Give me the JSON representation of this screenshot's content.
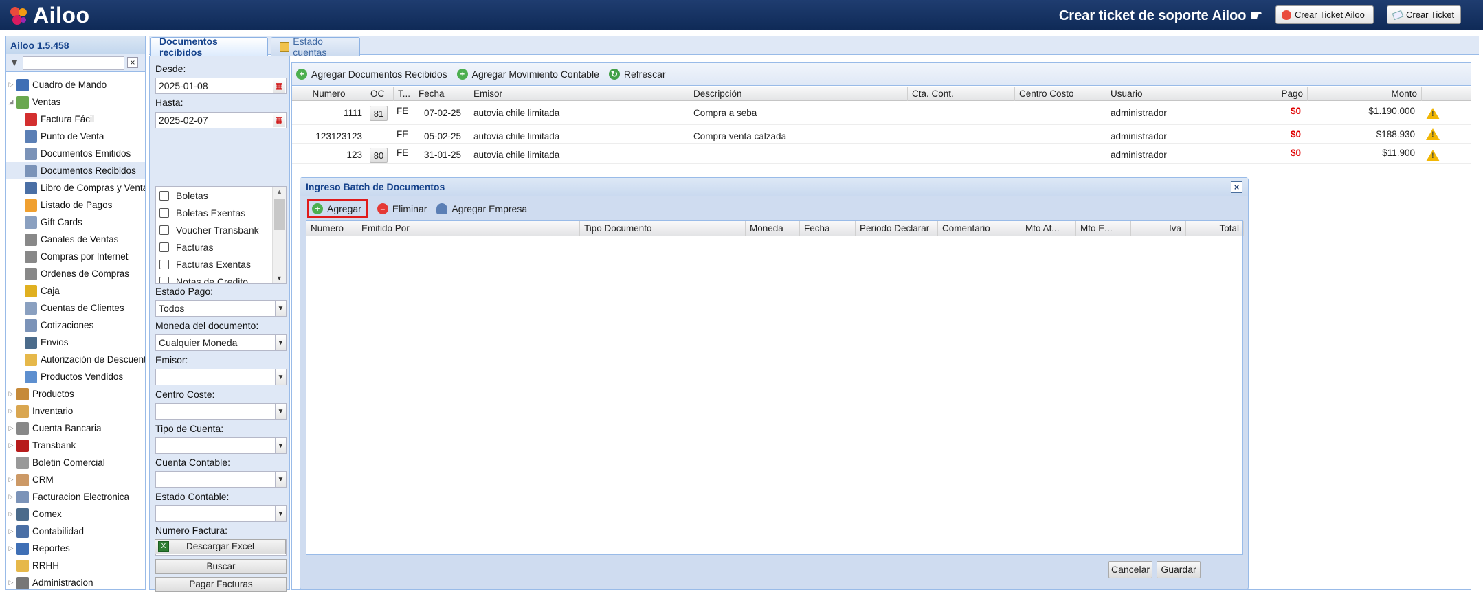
{
  "app": {
    "logo_text": "Ailoo",
    "support_title": "Crear ticket de soporte Ailoo ☛",
    "btn_crear_ticket_ailoo": "Crear Ticket Ailoo",
    "btn_crear_ticket": "Crear Ticket"
  },
  "sidebar": {
    "title": "Ailoo 1.5.458",
    "search_placeholder": "",
    "items": [
      {
        "label": "Cuadro de Mando",
        "icon": "chart-icon",
        "level": 0,
        "expander": "▷"
      },
      {
        "label": "Ventas",
        "icon": "money-icon",
        "level": 0,
        "expander": "◢"
      },
      {
        "label": "Factura Fácil",
        "icon": "ribbon-icon",
        "level": 1
      },
      {
        "label": "Punto de Venta",
        "icon": "pos-icon",
        "level": 1
      },
      {
        "label": "Documentos Emitidos",
        "icon": "document-icon",
        "level": 1
      },
      {
        "label": "Documentos Recibidos",
        "icon": "document-icon",
        "level": 1,
        "selected": true
      },
      {
        "label": "Libro de Compras y Ventas",
        "icon": "book-icon",
        "level": 1
      },
      {
        "label": "Listado de Pagos",
        "icon": "calculator-icon",
        "level": 1
      },
      {
        "label": "Gift Cards",
        "icon": "card-icon",
        "level": 1
      },
      {
        "label": "Canales de Ventas",
        "icon": "cart-icon",
        "level": 1
      },
      {
        "label": "Compras por Internet",
        "icon": "cart-icon",
        "level": 1
      },
      {
        "label": "Ordenes de Compras",
        "icon": "cart-icon",
        "level": 1
      },
      {
        "label": "Caja",
        "icon": "coins-icon",
        "level": 1
      },
      {
        "label": "Cuentas de Clientes",
        "icon": "card-icon",
        "level": 1
      },
      {
        "label": "Cotizaciones",
        "icon": "document-icon",
        "level": 1
      },
      {
        "label": "Envios",
        "icon": "truck-icon",
        "level": 1
      },
      {
        "label": "Autorización de Descuentos",
        "icon": "folder-icon",
        "level": 1
      },
      {
        "label": "Productos Vendidos",
        "icon": "table-icon",
        "level": 1
      },
      {
        "label": "Productos",
        "icon": "box-icon",
        "level": 0,
        "expander": "▷"
      },
      {
        "label": "Inventario",
        "icon": "package-icon",
        "level": 0,
        "expander": "▷"
      },
      {
        "label": "Cuenta Bancaria",
        "icon": "bank-icon",
        "level": 0,
        "expander": "▷"
      },
      {
        "label": "Transbank",
        "icon": "transbank-icon",
        "level": 0,
        "expander": "▷"
      },
      {
        "label": "Boletin Comercial",
        "icon": "tag-icon",
        "level": 0,
        "expander": ""
      },
      {
        "label": "CRM",
        "icon": "users-icon",
        "level": 0,
        "expander": "▷"
      },
      {
        "label": "Facturacion Electronica",
        "icon": "document-icon",
        "level": 0,
        "expander": "▷"
      },
      {
        "label": "Comex",
        "icon": "truck-icon",
        "level": 0,
        "expander": "▷"
      },
      {
        "label": "Contabilidad",
        "icon": "book-icon",
        "level": 0,
        "expander": "▷"
      },
      {
        "label": "Reportes",
        "icon": "chart-icon",
        "level": 0,
        "expander": "▷"
      },
      {
        "label": "RRHH",
        "icon": "folder-icon",
        "level": 0,
        "expander": ""
      },
      {
        "label": "Administracion",
        "icon": "gear-icon",
        "level": 0,
        "expander": "▷"
      }
    ]
  },
  "tabs": [
    {
      "label": "Documentos recibidos",
      "active": true
    },
    {
      "label": "Estado cuentas",
      "active": false
    }
  ],
  "filters": {
    "desde_label": "Desde:",
    "desde_value": "2025-01-08",
    "hasta_label": "Hasta:",
    "hasta_value": "2025-02-07",
    "doc_types": [
      "Boletas",
      "Boletas Exentas",
      "Voucher Transbank",
      "Facturas",
      "Facturas Exentas",
      "Notas de Credito"
    ],
    "estado_pago_label": "Estado Pago:",
    "estado_pago_value": "Todos",
    "moneda_label": "Moneda del documento:",
    "moneda_value": "Cualquier Moneda",
    "emisor_label": "Emisor:",
    "centro_coste_label": "Centro Coste:",
    "tipo_cuenta_label": "Tipo de Cuenta:",
    "cuenta_contable_label": "Cuenta Contable:",
    "estado_contable_label": "Estado Contable:",
    "numero_factura_label": "Numero Factura:",
    "buscar": "Buscar",
    "pagar_facturas": "Pagar Facturas",
    "descargar_excel": "Descargar Excel"
  },
  "grid": {
    "toolbar": {
      "agregar_docs": "Agregar Documentos Recibidos",
      "agregar_mov": "Agregar Movimiento Contable",
      "refrescar": "Refrescar"
    },
    "columns": [
      "Numero",
      "OC",
      "T...",
      "Fecha",
      "Emisor",
      "Descripción",
      "Cta. Cont.",
      "Centro Costo",
      "Usuario",
      "Pago",
      "Monto"
    ],
    "rows": [
      {
        "numero": "1111",
        "oc": "81",
        "tipo": "FE",
        "fecha": "07-02-25",
        "emisor": "autovia chile limitada",
        "descripcion": "Compra a seba",
        "usuario": "administrador",
        "pago": "$0",
        "monto": "$1.190.000"
      },
      {
        "numero": "123123123",
        "oc": "",
        "tipo": "FE",
        "fecha": "05-02-25",
        "emisor": "autovia chile limitada",
        "descripcion": "Compra venta calzada",
        "usuario": "administrador",
        "pago": "$0",
        "monto": "$188.930"
      },
      {
        "numero": "123",
        "oc": "80",
        "tipo": "FE",
        "fecha": "31-01-25",
        "emisor": "autovia chile limitada",
        "descripcion": "",
        "usuario": "administrador",
        "pago": "$0",
        "monto": "$11.900"
      }
    ],
    "warning_glyph": "!"
  },
  "batch": {
    "title": "Ingreso Batch de Documentos",
    "close": "×",
    "agregar": "Agregar",
    "eliminar": "Eliminar",
    "agregar_empresa": "Agregar Empresa",
    "columns": [
      "Numero",
      "Emitido Por",
      "Tipo Documento",
      "Moneda",
      "Fecha",
      "Periodo Declarar",
      "Comentario",
      "Mto Af...",
      "Mto E...",
      "Iva",
      "Total"
    ],
    "cancelar": "Cancelar",
    "guardar": "Guardar"
  },
  "colors": {
    "topbar": "#1f3d70",
    "header_text": "#15428b",
    "panel_bg": "#dfe8f6",
    "pago_red": "#e00000",
    "highlight": "#e01b1b"
  }
}
